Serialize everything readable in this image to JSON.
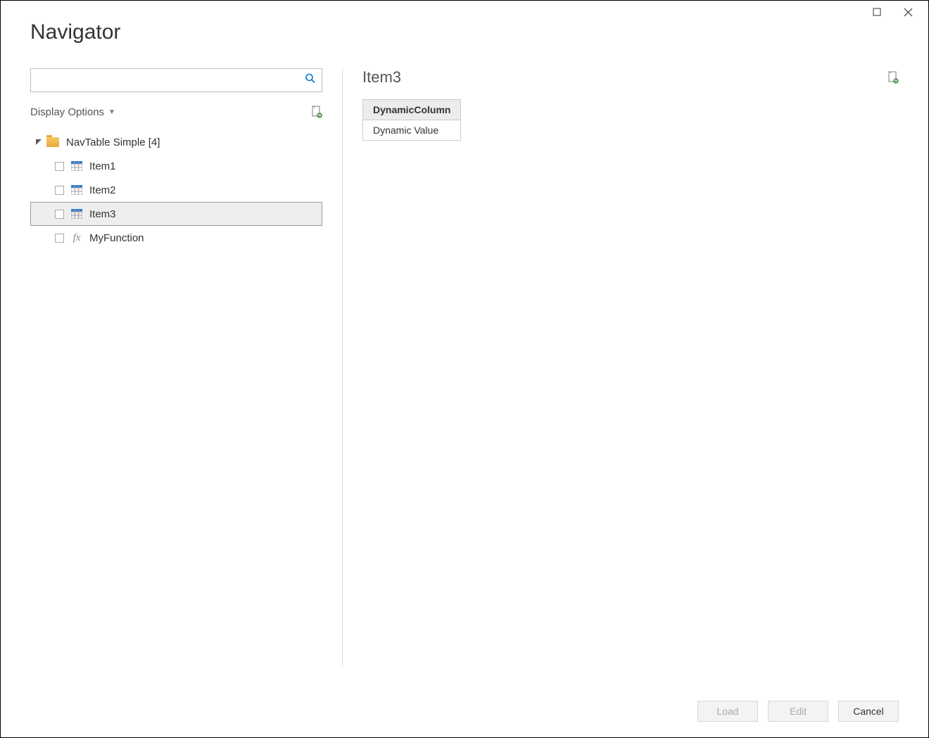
{
  "window": {
    "title": "Navigator"
  },
  "search": {
    "value": "",
    "placeholder": ""
  },
  "options": {
    "display_label": "Display Options"
  },
  "tree": {
    "root_label": "NavTable Simple [4]",
    "items": [
      {
        "label": "Item1",
        "type": "table",
        "selected": false
      },
      {
        "label": "Item2",
        "type": "table",
        "selected": false
      },
      {
        "label": "Item3",
        "type": "table",
        "selected": true
      },
      {
        "label": "MyFunction",
        "type": "function",
        "selected": false
      }
    ]
  },
  "preview": {
    "title": "Item3",
    "columns": [
      "DynamicColumn"
    ],
    "rows": [
      [
        "Dynamic Value"
      ]
    ]
  },
  "buttons": {
    "load": "Load",
    "edit": "Edit",
    "cancel": "Cancel"
  }
}
